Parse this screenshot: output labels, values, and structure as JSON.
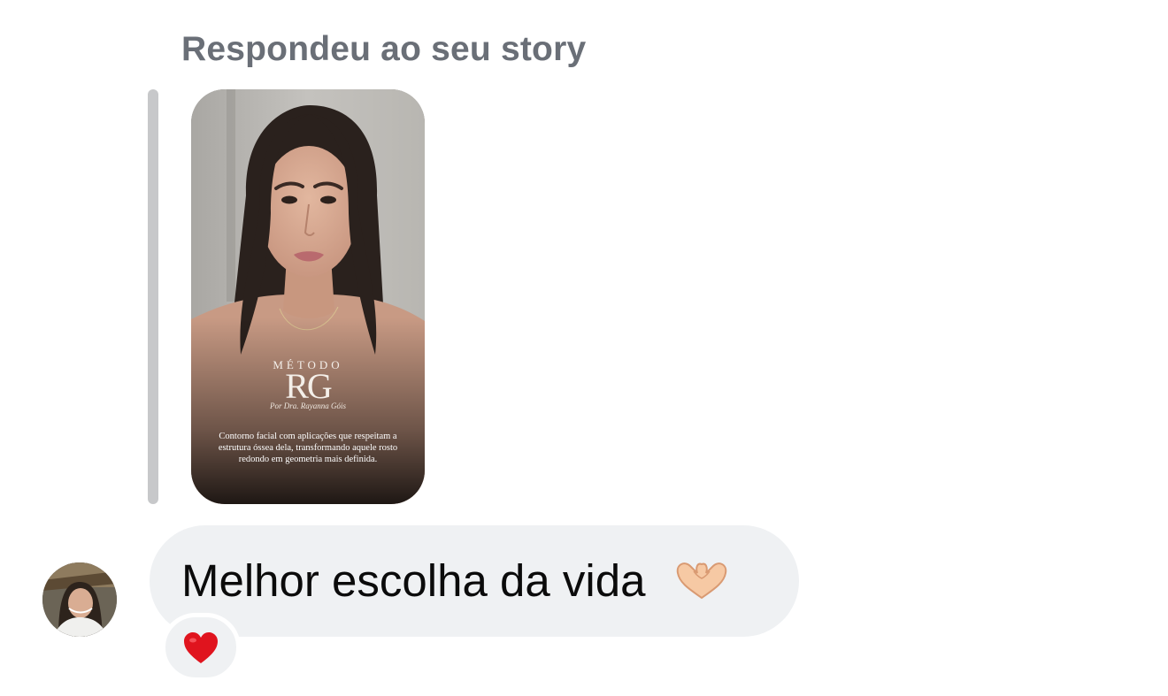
{
  "header": {
    "replied_to_story": "Respondeu ao seu story"
  },
  "story": {
    "brand_top": "MÉTODO",
    "brand_logo": "RG",
    "brand_sub": "Por Dra. Rayanna Góis",
    "caption": "Contorno facial com aplicações que respeitam a estrutura óssea dela, transformando aquele rosto redondo em geometria mais definida."
  },
  "message": {
    "text": "Melhor escolha da vida",
    "emoji": "🫶",
    "reaction_icon": "heart-icon",
    "reaction_color": "#e0141e"
  },
  "colors": {
    "bubble_bg": "#eff1f3",
    "label_gray": "#6a6f77",
    "quote_bar": "#c7c8ca"
  }
}
